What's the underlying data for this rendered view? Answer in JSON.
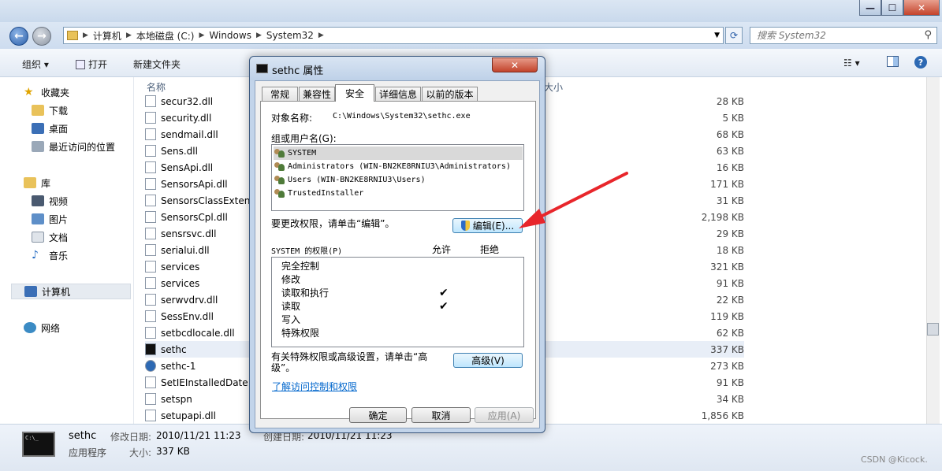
{
  "explorer": {
    "breadcrumb": [
      "计算机",
      "本地磁盘 (C:)",
      "Windows",
      "System32"
    ],
    "search_placeholder": "搜索 System32",
    "toolbar": {
      "organize": "组织 ▾",
      "open": "打开",
      "new_folder": "新建文件夹"
    },
    "columns": {
      "name": "名称",
      "size": "大小"
    },
    "nav": {
      "favorites": "收藏夹",
      "downloads": "下载",
      "desktop": "桌面",
      "recent": "最近访问的位置",
      "library": "库",
      "video": "视频",
      "pictures": "图片",
      "documents": "文档",
      "music": "音乐",
      "computer": "计算机",
      "network": "网络"
    },
    "files": [
      {
        "name": "secur32.dll",
        "size": "28 KB"
      },
      {
        "name": "security.dll",
        "size": "5 KB"
      },
      {
        "name": "sendmail.dll",
        "size": "68 KB"
      },
      {
        "name": "Sens.dll",
        "size": "63 KB"
      },
      {
        "name": "SensApi.dll",
        "size": "16 KB"
      },
      {
        "name": "SensorsApi.dll",
        "size": "171 KB"
      },
      {
        "name": "SensorsClassExten",
        "size": "31 KB"
      },
      {
        "name": "SensorsCpl.dll",
        "size": "2,198 KB"
      },
      {
        "name": "sensrsvc.dll",
        "size": "29 KB"
      },
      {
        "name": "serialui.dll",
        "size": "18 KB"
      },
      {
        "name": "services",
        "size": "321 KB"
      },
      {
        "name": "services",
        "size": "91 KB"
      },
      {
        "name": "serwvdrv.dll",
        "size": "22 KB"
      },
      {
        "name": "SessEnv.dll",
        "size": "119 KB"
      },
      {
        "name": "setbcdlocale.dll",
        "size": "62 KB"
      },
      {
        "name": "sethc",
        "size": "337 KB"
      },
      {
        "name": "sethc-1",
        "size": "273 KB"
      },
      {
        "name": "SetIEInstalledDate",
        "size": "91 KB"
      },
      {
        "name": "setspn",
        "size": "34 KB"
      },
      {
        "name": "setupapi.dll",
        "size": "1,856 KB"
      }
    ],
    "status": {
      "name": "sethc",
      "type": "应用程序",
      "modified_label": "修改日期:",
      "modified": "2010/11/21 11:23",
      "size_label": "大小:",
      "size": "337 KB",
      "created_label": "创建日期:",
      "created": "2010/11/21 11:23",
      "cmd_icon_text": "C:\\_"
    }
  },
  "dialog": {
    "title": "sethc 属性",
    "tabs": [
      "常规",
      "兼容性",
      "安全",
      "详细信息",
      "以前的版本"
    ],
    "object_label": "对象名称:",
    "object_value": "C:\\Windows\\System32\\sethc.exe",
    "group_label": "组或用户名(G):",
    "users": [
      "SYSTEM",
      "Administrators (WIN-BN2KE8RNIU3\\Administrators)",
      "Users (WIN-BN2KE8RNIU3\\Users)",
      "TrustedInstaller"
    ],
    "change_hint": "要更改权限，请单击“编辑”。",
    "edit_button": "编辑(E)...",
    "perm_label": "SYSTEM 的权限(P)",
    "allow": "允许",
    "deny": "拒绝",
    "permissions": [
      {
        "name": "完全控制",
        "allow": ""
      },
      {
        "name": "修改",
        "allow": ""
      },
      {
        "name": "读取和执行",
        "allow": "✔"
      },
      {
        "name": "读取",
        "allow": "✔"
      },
      {
        "name": "写入",
        "allow": ""
      },
      {
        "name": "特殊权限",
        "allow": ""
      }
    ],
    "advanced_hint": "有关特殊权限或高级设置，请单击“高级”。",
    "advanced_button": "高级(V)",
    "link": "了解访问控制和权限",
    "ok": "确定",
    "cancel": "取消",
    "apply": "应用(A)"
  },
  "watermark": "CSDN @Kicock.",
  "colors": {
    "accent": "#3c7fb1",
    "selection": "#e8eef7",
    "arrow": "#e8262b"
  }
}
